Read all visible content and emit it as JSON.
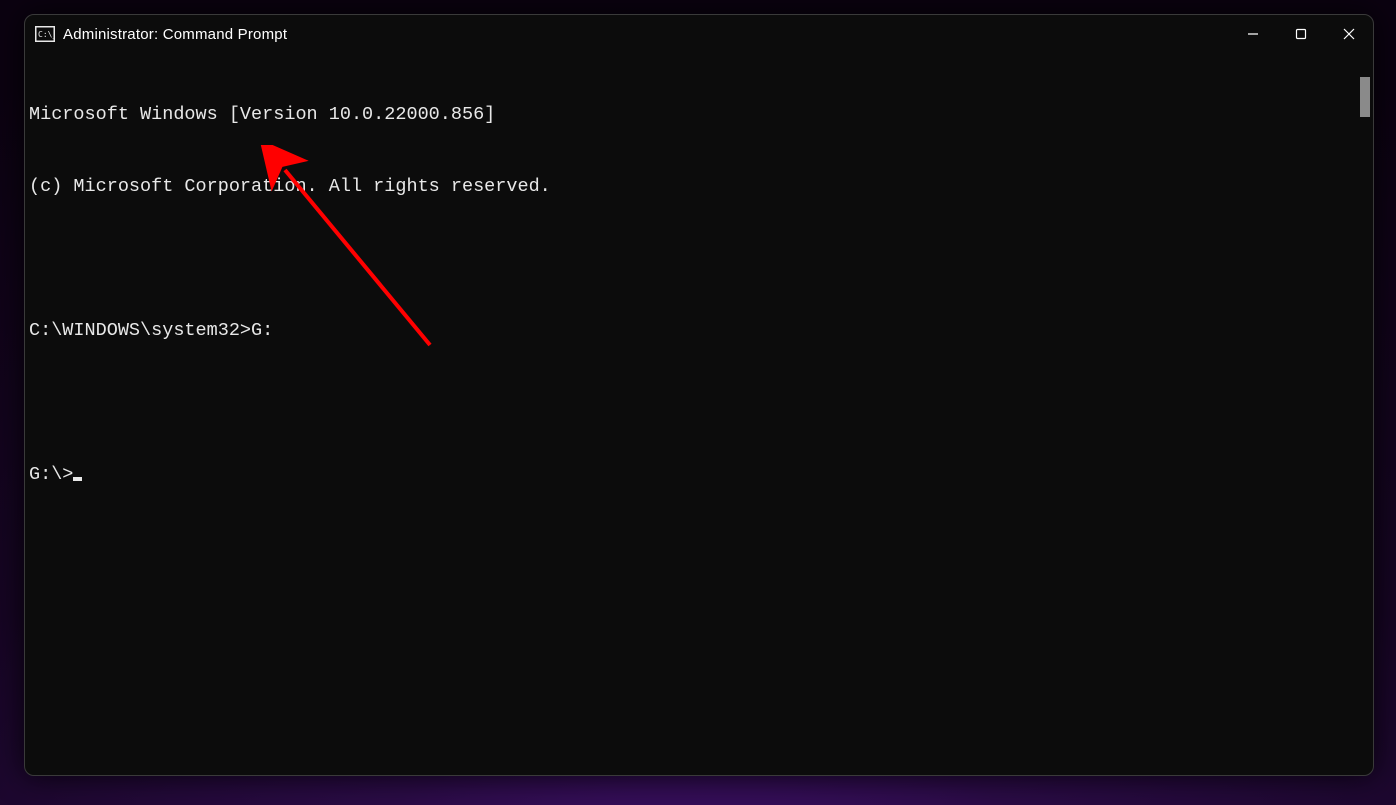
{
  "window": {
    "title": "Administrator: Command Prompt"
  },
  "terminal": {
    "lines": [
      "Microsoft Windows [Version 10.0.22000.856]",
      "(c) Microsoft Corporation. All rights reserved.",
      "",
      "C:\\WINDOWS\\system32>G:",
      "",
      "G:\\>"
    ]
  },
  "annotation": {
    "arrow_color": "#ff0000"
  }
}
